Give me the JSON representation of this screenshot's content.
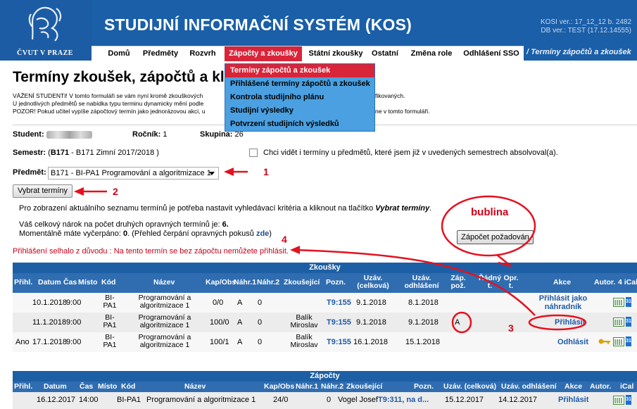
{
  "header": {
    "logo_text": "ČVUT V PRAZE",
    "app_title": "STUDIJNÍ INFORMAČNÍ SYSTÉM (KOS)",
    "version_line1": "KOSI ver.: 17_12_12 b. 2482",
    "version_line2": "DB ver.: TEST (17.12.14555)",
    "breadcrumb": "/ Termíny zápočtů a zkoušek"
  },
  "nav": {
    "items": [
      "Domů",
      "Předměty",
      "Rozvrh",
      "Zápočty a zkoušky",
      "Státní zkoušky",
      "Ostatní",
      "Změna role",
      "Odhlášení SSO"
    ]
  },
  "dropdown": {
    "items": [
      "Termíny zápočtů a zkoušek",
      "Přihlášené termíny zápočtů a zkoušek",
      "Kontrola studijního plánu",
      "Studijní výsledky",
      "Potvrzení studijních výsledků"
    ]
  },
  "page": {
    "title": "Termíny zkoušek, zápočtů a klas",
    "intro_line1": "VÁŽENÍ STUDENTI! V tomto formuláři se vám nyní kromě zkouškových",
    "intro_line2": "U jednotlivých předmětů se nabídka typu terminu dynamicky mění podle",
    "intro_line3": "POZOR! Pokud učitel vypíše zápočtový termín jako jednorázovou akci, u",
    "intro_right1": "fikovaných.",
    "intro_right3": "ne v tomto formuláři."
  },
  "student": {
    "label": "Student:",
    "rocnik_label": "Ročník:",
    "rocnik": "1",
    "skupina_label": "Skupina:",
    "skupina": "26"
  },
  "semestr": {
    "label": "Semestr:",
    "prefix": "(",
    "code": "B171",
    "rest": "- B171 Zimní 2017/2018 )",
    "checkbox_label": "Chci vidět i termíny u předmětů, které jsem již v uvedených semestrech absolvoval(a)."
  },
  "predmet": {
    "label": "Předmět:",
    "value": "B171 - BI-PA1 Programování a algoritmizace 1"
  },
  "buttons": {
    "vybrat": "Vybrat termíny",
    "bubble": "Zápočet požadován"
  },
  "info": {
    "line1_pre": "Pro zobrazení aktuálního seznamu termínů je potřeba nastavit vyhledávací kritéria a kliknout na tlačítko",
    "line1_bold": "Vybrat termíny",
    "line1_end": ".",
    "line2_pre": "Váš celkový nárok na počet druhých opravných termínů je:",
    "line2_val": "6.",
    "line3_pre": "Momentálně máte vyčerpáno:",
    "line3_val": "0",
    "line3_mid": ". (Přehled čerpání opravných pokusů",
    "line3_link": "zde",
    "line3_end": ")",
    "error": "Přihlášení selhalo z důvodu : Na tento termín se bez zápočtu nemůžete přihlásit."
  },
  "annotations": {
    "n1": "1",
    "n2": "2",
    "n3": "3",
    "n4": "4",
    "bubble_title": "bublina"
  },
  "zkousky": {
    "title": "Zkoušky",
    "headers": [
      "Přihl.",
      "Datum",
      "Čas",
      "Místo",
      "Kód",
      "Název",
      "Kap/Obs",
      "Náhr.1",
      "Náhr.2",
      "Zkoušející",
      "Pozn.",
      "Uzáv. (celková)",
      "Uzáv. odhlášení",
      "Záp. pož.",
      "Řádný t.",
      "Opr. t.",
      "Akce",
      "Autor.",
      "4 iCal"
    ],
    "rows": [
      {
        "prihl": "",
        "datum": "10.1.2018",
        "cas": "9:00",
        "kod": "BI-PA1",
        "nazev": "Programování a algoritmizace 1",
        "kap": "0/0",
        "nahr1": "A",
        "nahr2": "0",
        "zkousejici": "",
        "pozn": "T9:155",
        "uzav": "9.1.2018",
        "odhl": "8.1.2018",
        "zap": "",
        "akce": "Přihlásit jako náhradník"
      },
      {
        "prihl": "",
        "datum": "11.1.2018",
        "cas": "9:00",
        "kod": "BI-PA1",
        "nazev": "Programování a algoritmizace 1",
        "kap": "100/0",
        "nahr1": "A",
        "nahr2": "0",
        "zkousejici": "Balík Miroslav",
        "pozn": "T9:155",
        "uzav": "9.1.2018",
        "odhl": "9.1.2018",
        "zap": "A",
        "akce": "Přihlásit"
      },
      {
        "prihl": "Ano",
        "datum": "17.1.2018",
        "cas": "9:00",
        "kod": "BI-PA1",
        "nazev": "Programování a algoritmizace 1",
        "kap": "100/1",
        "nahr1": "A",
        "nahr2": "0",
        "zkousejici": "Balík Miroslav",
        "pozn": "T9:155",
        "uzav": "16.1.2018",
        "odhl": "15.1.2018",
        "zap": "",
        "akce": "Odhlásit"
      }
    ]
  },
  "zapocty": {
    "title": "Zápočty",
    "headers": [
      "Přihl.",
      "Datum",
      "Čas",
      "Místo",
      "Kód",
      "Název",
      "Kap/Obs",
      "Náhr.1",
      "Náhr.2",
      "Zkoušející",
      "Pozn.",
      "Uzáv. (celková)",
      "Uzáv. odhlášení",
      "Akce",
      "Autor.",
      "iCal"
    ],
    "rows": [
      {
        "datum": "16.12.2017",
        "cas": "14:00",
        "kod": "BI-PA1",
        "nazev": "Programování a algoritmizace 1",
        "kap": "24/0",
        "nahr2": "0",
        "zkousejici": "Vogel Josef",
        "pozn": "T9:311, na d...",
        "uzav": "15.12.2017",
        "odhl": "14.12.2017",
        "akce": "Přihlásit"
      }
    ]
  },
  "colors": {
    "brand_blue": "#1a5fa8",
    "accent_red": "#d9253a",
    "dropdown_blue": "#4aa0e0"
  }
}
